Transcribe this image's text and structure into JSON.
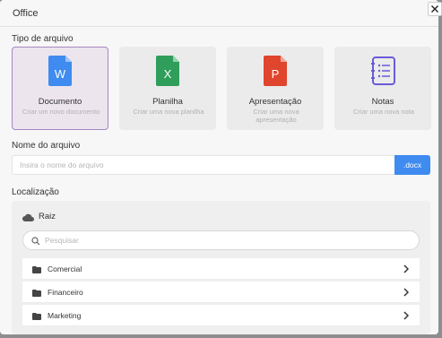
{
  "dialog": {
    "title": "Office"
  },
  "file_type": {
    "label": "Tipo de arquivo",
    "options": [
      {
        "title": "Documento",
        "subtitle": "Criar um novo documento",
        "icon": "word-doc-icon",
        "color": "#3f8bf0",
        "letter": "W",
        "selected": true
      },
      {
        "title": "Planilha",
        "subtitle": "Criar uma nova planilha",
        "icon": "spreadsheet-icon",
        "color": "#2f9e5b",
        "letter": "X",
        "selected": false
      },
      {
        "title": "Apresentação",
        "subtitle": "Criar uma nova apresentação",
        "icon": "presentation-icon",
        "color": "#e0452d",
        "letter": "P",
        "selected": false
      },
      {
        "title": "Notas",
        "subtitle": "Criar uma nova nota",
        "icon": "notes-icon",
        "color": "#6a5bd6",
        "letter": "",
        "selected": false
      }
    ]
  },
  "file_name": {
    "label": "Nome do arquivo",
    "placeholder": "Insira o nome do arquivo",
    "value": "",
    "extension": ".docx"
  },
  "location": {
    "label": "Localização",
    "root": "Raiz",
    "search_placeholder": "Pesquisar",
    "folders": [
      {
        "name": "Comercial"
      },
      {
        "name": "Financeiro"
      },
      {
        "name": "Marketing"
      }
    ]
  },
  "colors": {
    "accent": "#3f8bf0",
    "selected_border": "#a787c1",
    "selected_bg": "#ece5ee"
  }
}
